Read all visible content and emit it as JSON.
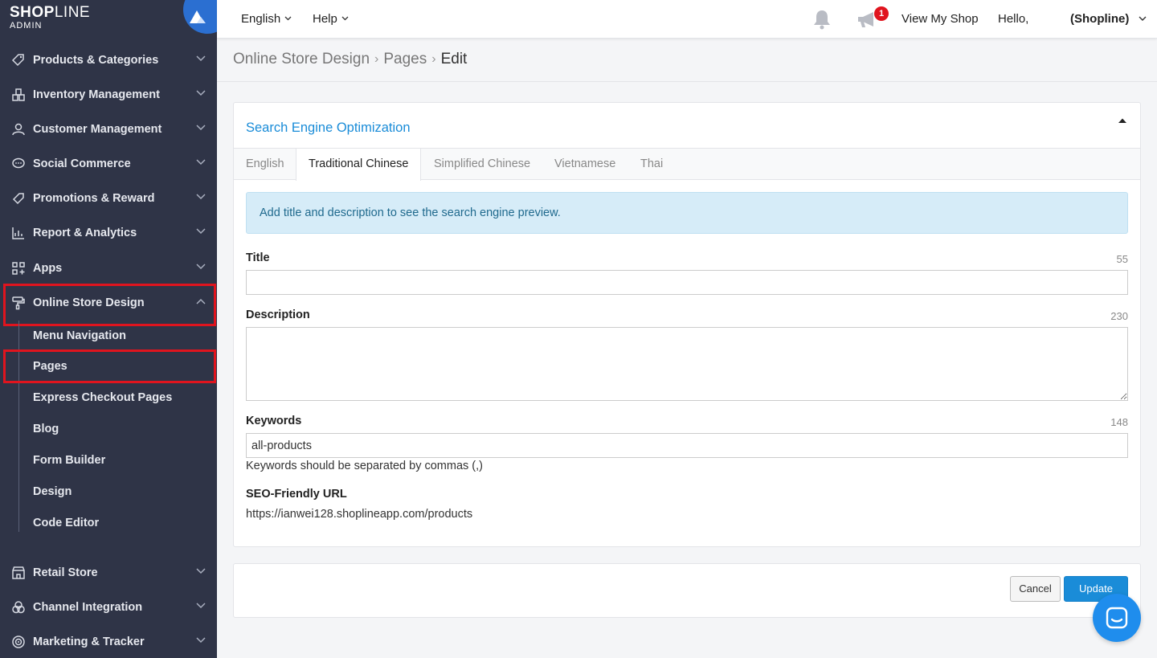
{
  "brand": {
    "name_bold": "SHOP",
    "name_light": "LINE",
    "sub": "ADMIN"
  },
  "sidebar": {
    "items": [
      {
        "label": "Products & Categories",
        "icon": "tag-icon"
      },
      {
        "label": "Inventory Management",
        "icon": "boxes-icon"
      },
      {
        "label": "Customer Management",
        "icon": "person-icon"
      },
      {
        "label": "Social Commerce",
        "icon": "chat-bubble-icon"
      },
      {
        "label": "Promotions & Reward",
        "icon": "ticket-icon"
      },
      {
        "label": "Report & Analytics",
        "icon": "chart-icon"
      },
      {
        "label": "Apps",
        "icon": "apps-grid-icon"
      },
      {
        "label": "Online Store Design",
        "icon": "paint-roller-icon",
        "expanded": true
      },
      {
        "label": "Retail Store",
        "icon": "store-icon"
      },
      {
        "label": "Channel Integration",
        "icon": "channels-icon"
      },
      {
        "label": "Marketing & Tracker",
        "icon": "target-icon"
      }
    ],
    "sub_items": [
      "Menu Navigation",
      "Pages",
      "Express Checkout Pages",
      "Blog",
      "Form Builder",
      "Design",
      "Code Editor"
    ],
    "highlight_color": "#e0141e"
  },
  "topbar": {
    "language": "English",
    "help": "Help",
    "notification_count": "1",
    "view_shop": "View My Shop",
    "hello": "Hello,",
    "account": "(Shopline)"
  },
  "breadcrumb": {
    "level1": "Online Store Design",
    "level2": "Pages",
    "current": "Edit"
  },
  "seo": {
    "title": "Search Engine Optimization",
    "tabs": [
      "English",
      "Traditional Chinese",
      "Simplified Chinese",
      "Vietnamese",
      "Thai"
    ],
    "active_tab": "Traditional Chinese",
    "info": "Add title and description to see the search engine preview.",
    "title_label": "Title",
    "title_count": "55",
    "title_value": "",
    "description_label": "Description",
    "description_count": "230",
    "description_value": "",
    "keywords_label": "Keywords",
    "keywords_count": "148",
    "keywords_value": "all-products",
    "keywords_hint": "Keywords should be separated by commas (,)",
    "url_label": "SEO-Friendly URL",
    "url_value": "https://ianwei128.shoplineapp.com/products"
  },
  "actions": {
    "cancel": "Cancel",
    "update": "Update"
  },
  "colors": {
    "sidebar_bg": "#2f3447",
    "accent": "#1a8cd8",
    "badge": "#e0141e"
  }
}
